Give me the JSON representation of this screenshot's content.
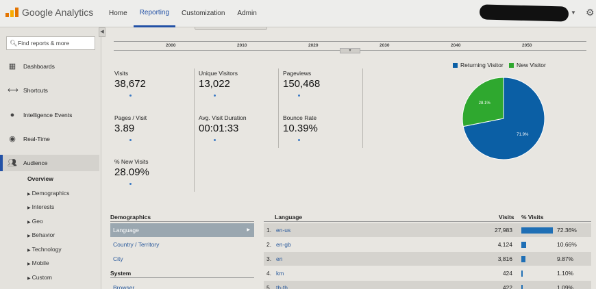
{
  "brand": {
    "logo_text": "Google Analytics"
  },
  "topnav": [
    "Home",
    "Reporting",
    "Customization",
    "Admin"
  ],
  "sidebar": {
    "search_placeholder": "Find reports & more",
    "items": [
      {
        "label": "Dashboards",
        "icon": "grid-icon"
      },
      {
        "label": "Shortcuts",
        "icon": "arrows-icon"
      },
      {
        "label": "Intelligence Events",
        "icon": "bulb-icon"
      },
      {
        "label": "Real-Time",
        "icon": "clock-icon"
      },
      {
        "label": "Audience",
        "icon": "people-icon"
      }
    ],
    "subitems": [
      "Overview",
      "Demographics",
      "Interests",
      "Geo",
      "Behavior",
      "Technology",
      "Mobile",
      "Custom"
    ]
  },
  "timeline": [
    "2000",
    "2010",
    "2020",
    "2030",
    "2040",
    "2050"
  ],
  "metrics": [
    {
      "label": "Visits",
      "value": "38,672"
    },
    {
      "label": "Unique Visitors",
      "value": "13,022"
    },
    {
      "label": "Pageviews",
      "value": "150,468"
    },
    {
      "label": "Pages / Visit",
      "value": "3.89"
    },
    {
      "label": "Avg. Visit Duration",
      "value": "00:01:33"
    },
    {
      "label": "Bounce Rate",
      "value": "10.39%"
    },
    {
      "label": "% New Visits",
      "value": "28.09%"
    }
  ],
  "chart_data": {
    "type": "pie",
    "series": [
      {
        "name": "Returning Visitor",
        "value": 71.9,
        "color": "#0b5fa5"
      },
      {
        "name": "New Visitor",
        "value": 28.1,
        "color": "#2fa82f"
      }
    ],
    "slice_labels": [
      "71.9%",
      "28.1%"
    ],
    "legend_position": "top"
  },
  "demographics": {
    "heading": "Demographics",
    "rows": [
      "Language",
      "Country / Territory",
      "City"
    ],
    "system_heading": "System",
    "system_rows": [
      "Browser"
    ]
  },
  "language_table": {
    "headers": {
      "name": "Language",
      "visits": "Visits",
      "pct": "% Visits"
    },
    "rows": [
      {
        "num": "1.",
        "name": "en-us",
        "visits": "27,983",
        "pct": "72.36%",
        "share": 72.36
      },
      {
        "num": "2.",
        "name": "en-gb",
        "visits": "4,124",
        "pct": "10.66%",
        "share": 10.66
      },
      {
        "num": "3.",
        "name": "en",
        "visits": "3,816",
        "pct": "9.87%",
        "share": 9.87
      },
      {
        "num": "4.",
        "name": "km",
        "visits": "424",
        "pct": "1.10%",
        "share": 1.1
      },
      {
        "num": "5.",
        "name": "th-th",
        "visits": "422",
        "pct": "1.09%",
        "share": 1.09
      }
    ]
  }
}
